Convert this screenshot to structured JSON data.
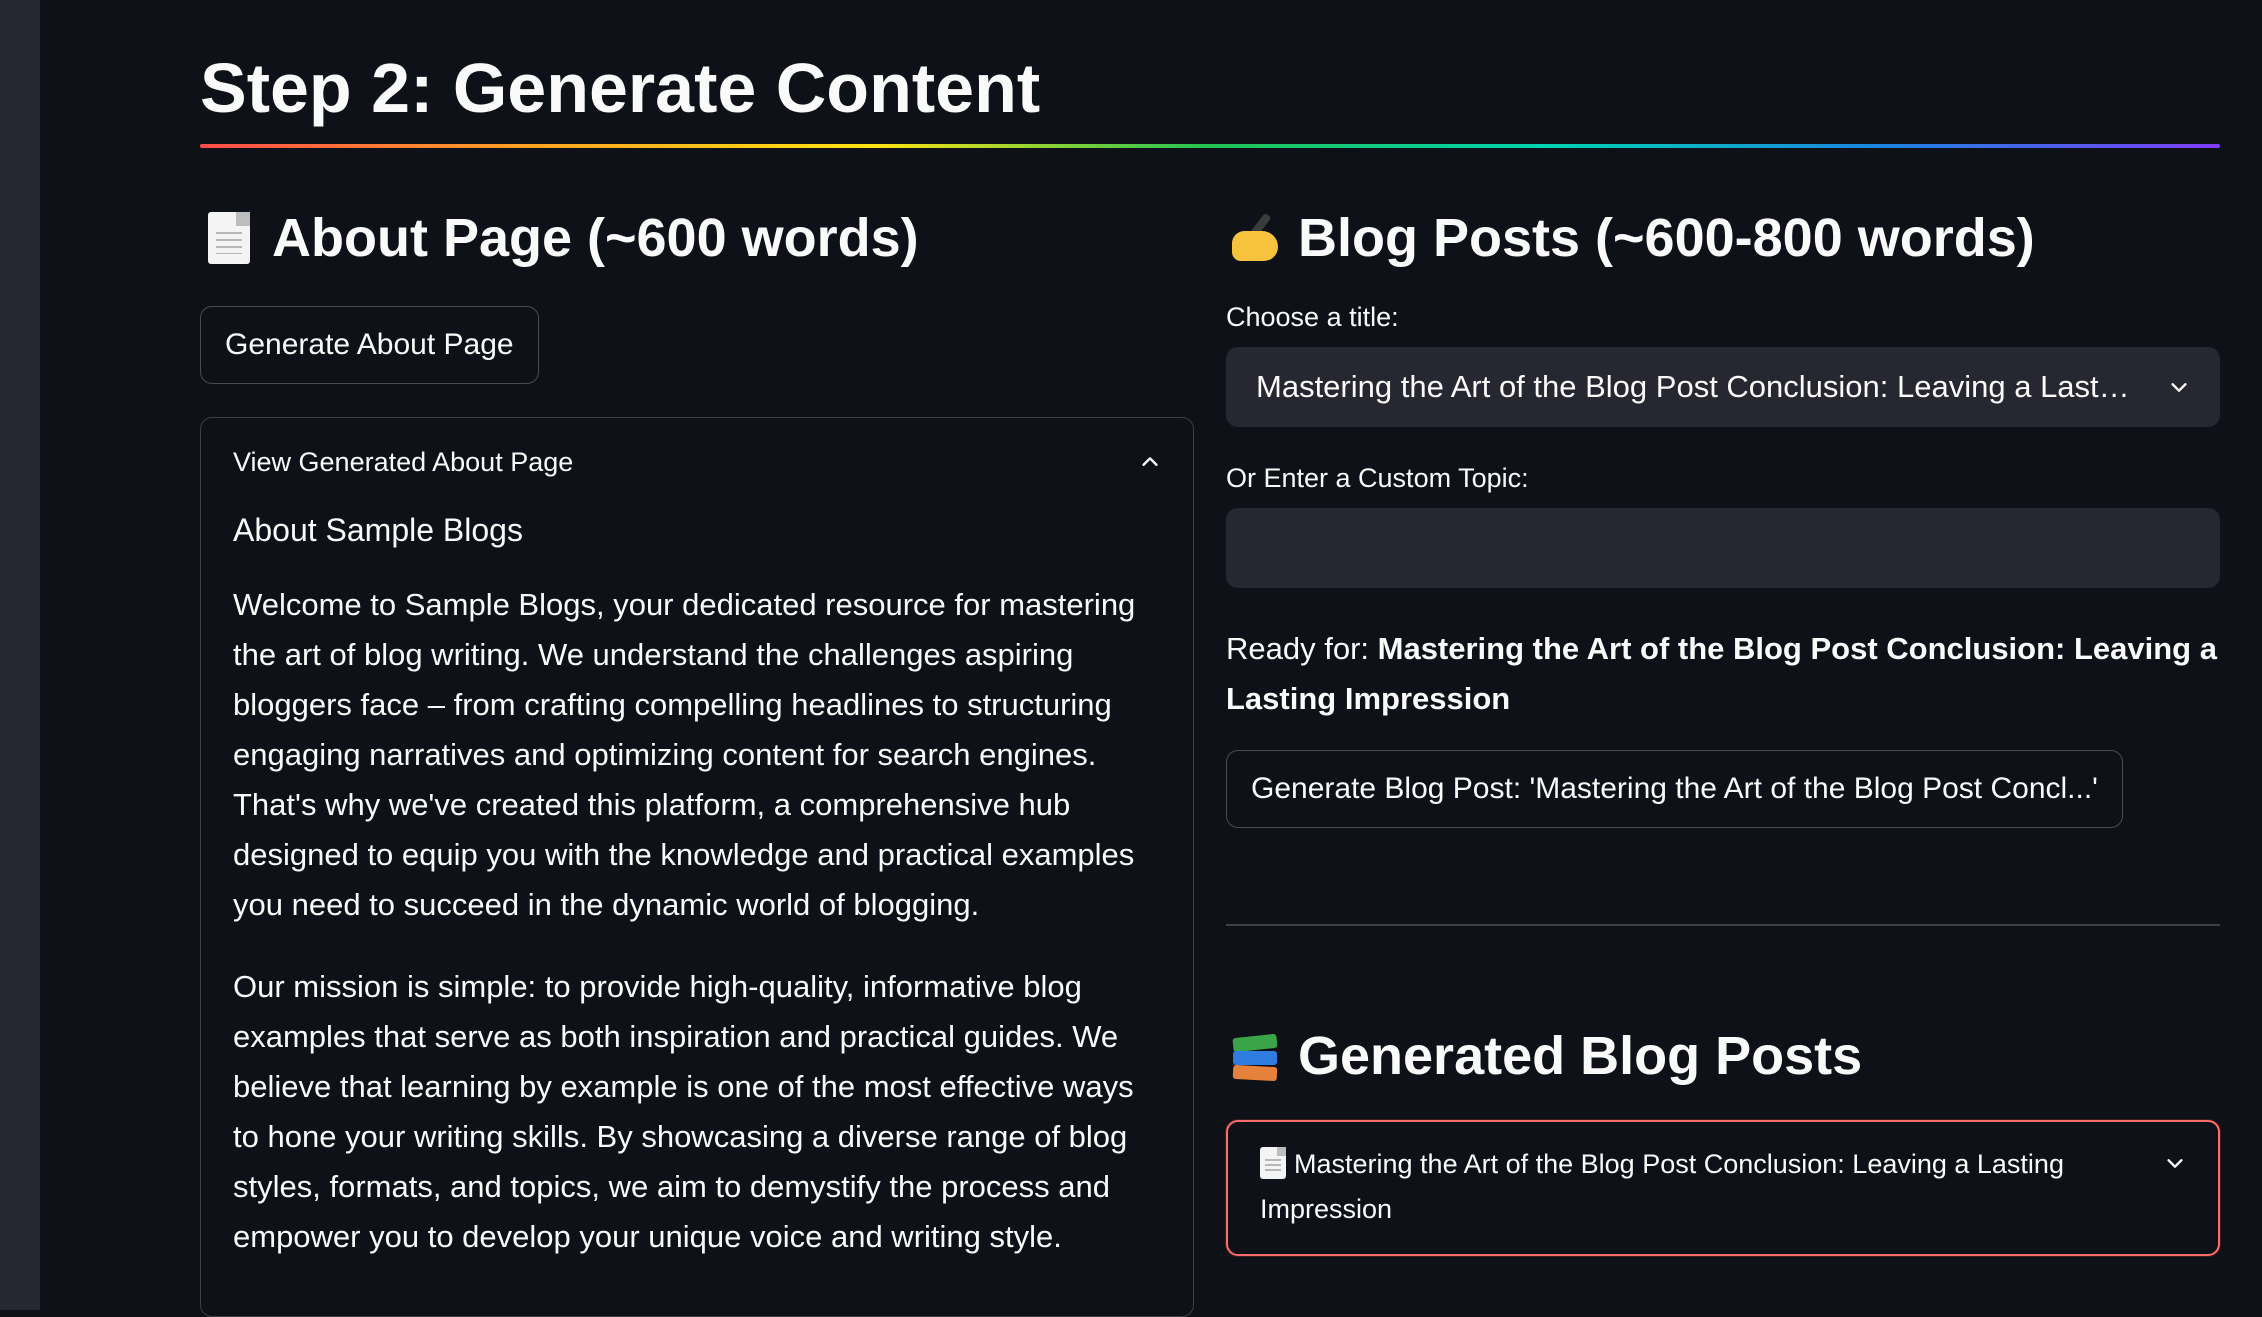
{
  "page": {
    "title": "Step 2: Generate Content"
  },
  "about": {
    "heading": "About Page (~600 words)",
    "heading_icon": "page-document-icon",
    "generate_button": "Generate About Page",
    "expander_label": "View Generated About Page",
    "content_title": "About Sample Blogs",
    "paragraphs": [
      "Welcome to Sample Blogs, your dedicated resource for mastering the art of blog writing. We understand the challenges aspiring bloggers face – from crafting compelling headlines to structuring engaging narratives and optimizing content for search engines. That's why we've created this platform, a comprehensive hub designed to equip you with the knowledge and practical examples you need to succeed in the dynamic world of blogging.",
      "Our mission is simple: to provide high-quality, informative blog examples that serve as both inspiration and practical guides. We believe that learning by example is one of the most effective ways to hone your writing skills. By showcasing a diverse range of blog styles, formats, and topics, we aim to demystify the process and empower you to develop your unique voice and writing style."
    ]
  },
  "blog": {
    "heading": "Blog Posts (~600-800 words)",
    "heading_icon": "writing-hand-icon",
    "choose_label": "Choose a title:",
    "selected_title": "Mastering the Art of the Blog Post Conclusion: Leaving a Lasting…",
    "custom_label": "Or Enter a Custom Topic:",
    "custom_value": "",
    "ready_prefix": "Ready for: ",
    "ready_title": "Mastering the Art of the Blog Post Conclusion: Leaving a Lasting Impression",
    "generate_button": "Generate Blog Post: 'Mastering the Art of the Blog Post Concl...'"
  },
  "generated": {
    "heading": "Generated Blog Posts",
    "heading_icon": "books-icon",
    "items": [
      {
        "label": "Mastering the Art of the Blog Post Conclusion: Leaving a Lasting Impression",
        "icon": "page-document-icon"
      }
    ]
  },
  "colors": {
    "background": "#0e1117",
    "secondary_background": "#262730",
    "accent_border": "#ff6c6c"
  }
}
